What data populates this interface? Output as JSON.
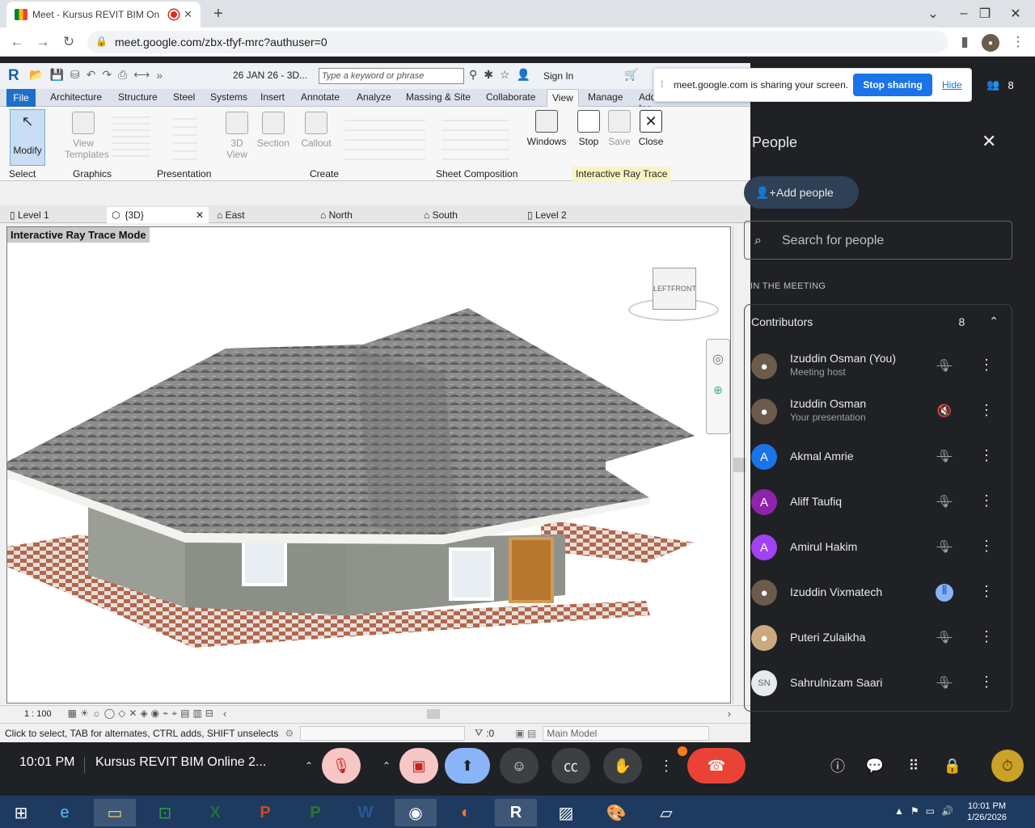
{
  "browser": {
    "tab_title": "Meet - Kursus REVIT BIM On",
    "url": "meet.google.com/zbx-tfyf-mrc?authuser=0"
  },
  "revit": {
    "doc_title": "26 JAN 26 - 3D...",
    "search_placeholder": "Type a keyword or phrase",
    "sign_in": "Sign In",
    "ribbon_tabs": [
      "File",
      "Architecture",
      "Structure",
      "Steel",
      "Systems",
      "Insert",
      "Annotate",
      "Analyze",
      "Massing & Site",
      "Collaborate",
      "View",
      "Manage",
      "Add-Ins"
    ],
    "ribbon_buttons": {
      "modify": "Modify",
      "view_templates": "View\nTemplates",
      "view3d": "3D\nView",
      "section": "Section",
      "callout": "Callout",
      "windows": "Windows",
      "stop": "Stop",
      "save": "Save",
      "close": "Close"
    },
    "groups": {
      "select": "Select",
      "graphics": "Graphics",
      "presentation": "Presentation",
      "create": "Create",
      "sheet_composition": "Sheet Composition",
      "interactive": "Interactive Ray Trace"
    },
    "view_tabs": [
      "Level 1",
      "{3D}",
      "East",
      "North",
      "South",
      "Level 2"
    ],
    "mode_label": "Interactive Ray Trace Mode",
    "viewcube": {
      "left": "LEFT",
      "front": "FRONT"
    },
    "scale": "1 : 100",
    "status_text": "Click to select, TAB for alternates, CTRL adds, SHIFT unselects",
    "selection_count": ":0",
    "model": "Main Model"
  },
  "share": {
    "message": "meet.google.com is sharing your screen.",
    "stop": "Stop sharing",
    "hide": "Hide",
    "count": "8"
  },
  "people": {
    "title": "People",
    "add": "Add people",
    "search_placeholder": "Search for people",
    "section": "IN THE MEETING",
    "group": "Contributors",
    "group_count": "8",
    "list": [
      {
        "name": "Izuddin Osman (You)",
        "sub": "Meeting host",
        "initial": "",
        "color": "#6b5b4b",
        "mic": "muted"
      },
      {
        "name": "Izuddin Osman",
        "sub": "Your presentation",
        "initial": "",
        "color": "#6b5b4b",
        "mic": "sound-off"
      },
      {
        "name": "Akmal Amrie",
        "sub": "",
        "initial": "A",
        "color": "#1a73e8",
        "mic": "muted"
      },
      {
        "name": "Aliff Taufiq",
        "sub": "",
        "initial": "A",
        "color": "#8e24aa",
        "mic": "muted"
      },
      {
        "name": "Amirul Hakim",
        "sub": "",
        "initial": "A",
        "color": "#a142f4",
        "mic": "muted"
      },
      {
        "name": "Izuddin Vixmatech",
        "sub": "",
        "initial": "",
        "color": "#6b5b4b",
        "mic": "speaking"
      },
      {
        "name": "Puteri Zulaikha",
        "sub": "",
        "initial": "",
        "color": "#c9a97d",
        "mic": "muted"
      },
      {
        "name": "Sahrulnizam Saari",
        "sub": "",
        "initial": "SN",
        "color": "#e8eaed",
        "mic": "muted"
      }
    ]
  },
  "meet": {
    "time": "10:01 PM",
    "meeting_name": "Kursus REVIT BIM Online 2..."
  },
  "taskbar": {
    "time": "10:01 PM",
    "date": "1/26/2026"
  }
}
